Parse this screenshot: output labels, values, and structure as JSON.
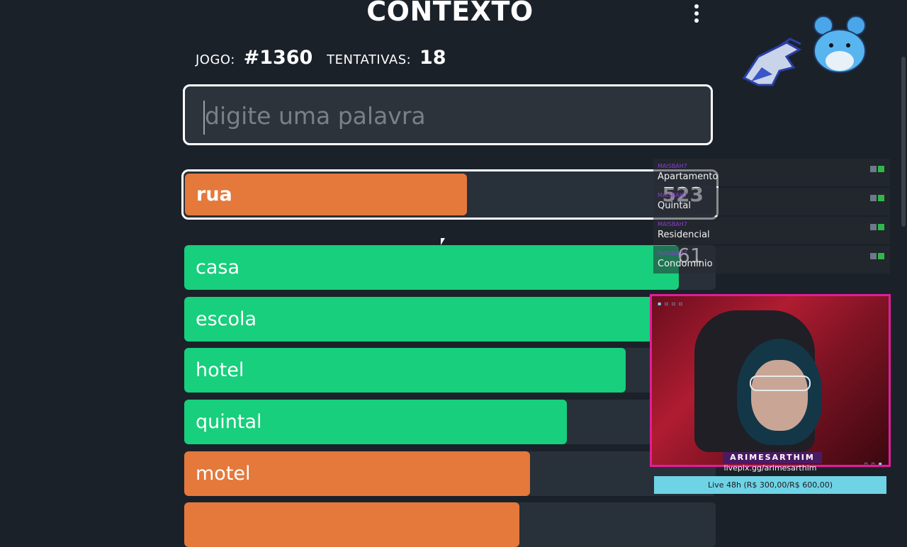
{
  "header": {
    "title": "CONTEXTO",
    "menu_icon": "kebab-menu-icon"
  },
  "info": {
    "game_label": "JOGO:",
    "game_value": "#1360",
    "attempts_label": "TENTATIVAS:",
    "attempts_value": "18"
  },
  "input": {
    "placeholder": "digite uma palavra"
  },
  "current_guess": {
    "word": "rua",
    "rank": "523",
    "fill_fraction": 0.53
  },
  "guesses": [
    {
      "word": "casa",
      "color": "green",
      "fill_fraction": 0.93
    },
    {
      "word": "escola",
      "color": "green",
      "fill_fraction": 0.93
    },
    {
      "word": "hotel",
      "color": "green",
      "fill_fraction": 0.83
    },
    {
      "word": "quintal",
      "color": "green",
      "fill_fraction": 0.72
    },
    {
      "word": "motel",
      "color": "orange",
      "fill_fraction": 0.65
    },
    {
      "word": "",
      "color": "orange",
      "fill_fraction": 0.63
    }
  ],
  "colors": {
    "green": "#17cf7c",
    "orange": "#e4793b",
    "background": "#1b2129"
  },
  "chat": [
    {
      "user": "MAISBAH7",
      "message": "Apartamento"
    },
    {
      "user": "MAISBAH7",
      "message": "Quintal"
    },
    {
      "user": "MAISBAH7",
      "message": "Residencial"
    },
    {
      "user": "MAISBAH7",
      "message": "Condominio",
      "overlay_number": "61"
    }
  ],
  "stream": {
    "streamer_name": "ARIMESARTHIM",
    "livepix": "livepix.gg/arimesarthim",
    "goal_text": "Live 48h (R$ 300,00/R$ 600,00)"
  }
}
